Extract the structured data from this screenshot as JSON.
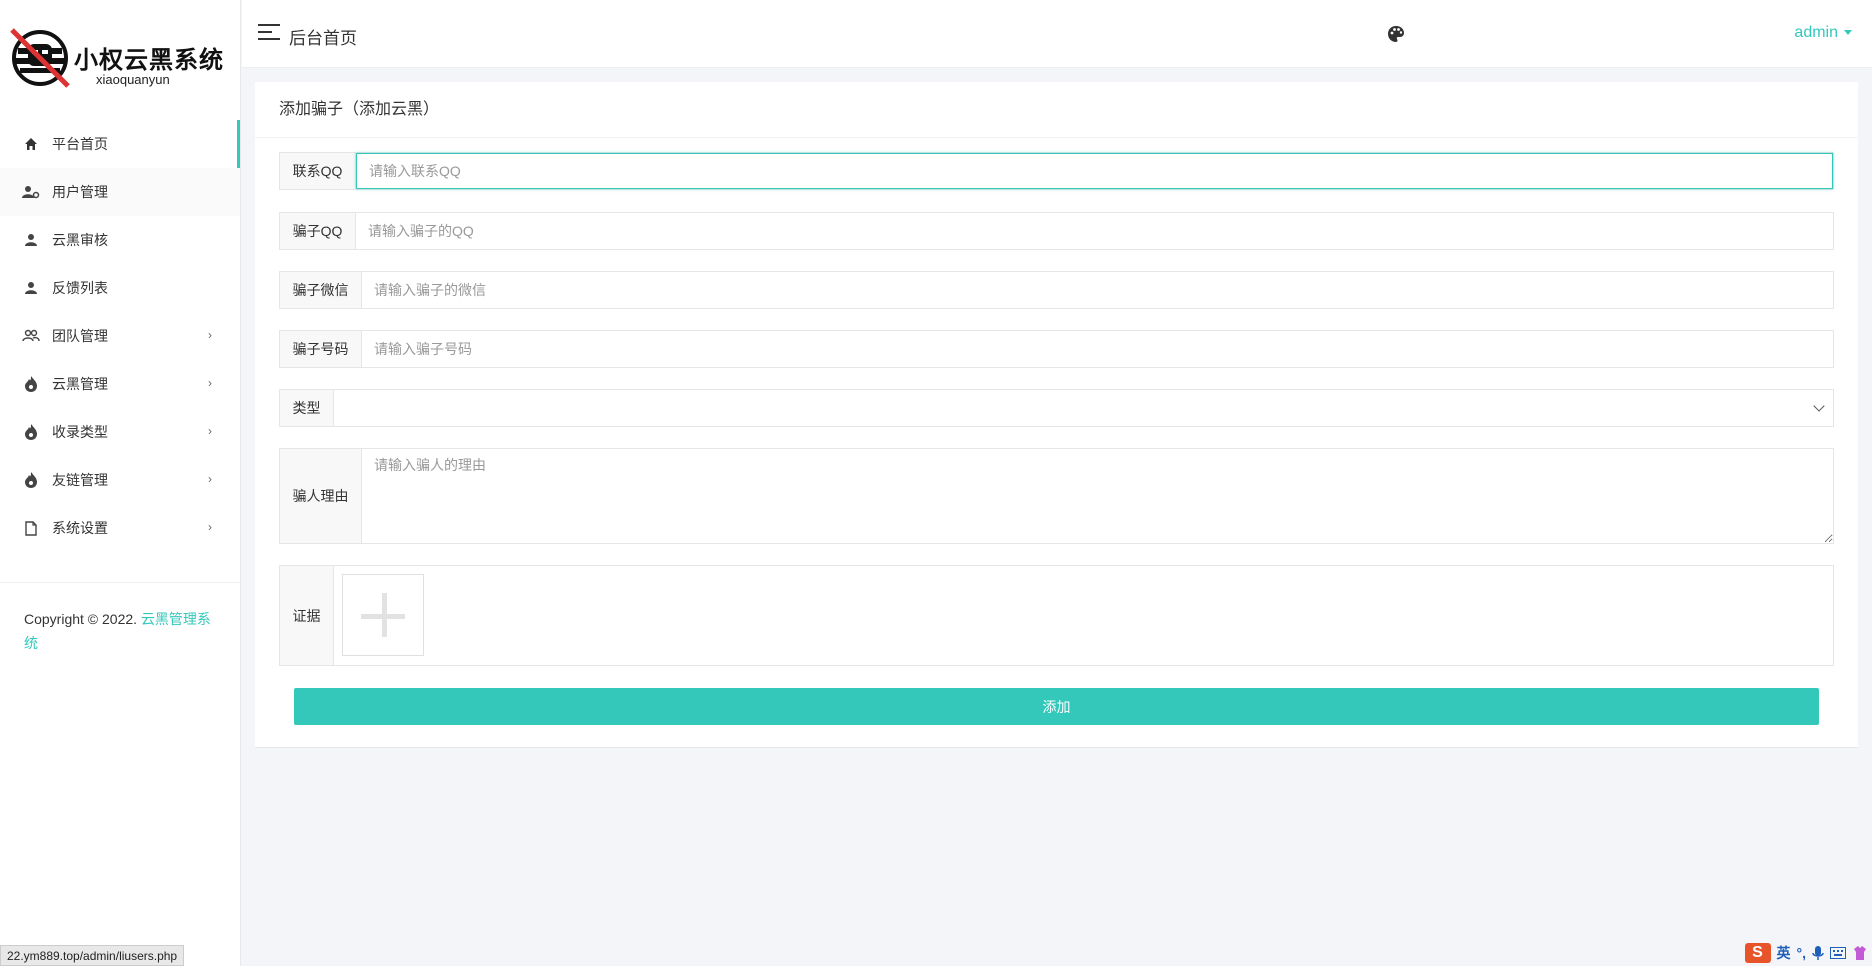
{
  "logo": {
    "title": "小权云黑系统",
    "subtitle": "xiaoquanyun"
  },
  "sidebar": {
    "items": [
      {
        "label": "平台首页",
        "icon": "home-icon"
      },
      {
        "label": "用户管理",
        "icon": "user-settings-icon"
      },
      {
        "label": "云黑审核",
        "icon": "user-icon"
      },
      {
        "label": "反馈列表",
        "icon": "user-icon"
      },
      {
        "label": "团队管理",
        "icon": "group-icon",
        "arrow": "›"
      },
      {
        "label": "云黑管理",
        "icon": "flame-icon",
        "arrow": "›"
      },
      {
        "label": "收录类型",
        "icon": "flame-icon",
        "arrow": "›"
      },
      {
        "label": "友链管理",
        "icon": "flame-icon",
        "arrow": "›"
      },
      {
        "label": "系统设置",
        "icon": "file-icon",
        "arrow": "›"
      }
    ],
    "copyright_text": "Copyright © 2022. ",
    "copyright_link": "云黑管理系统"
  },
  "header": {
    "title": "后台首页",
    "user": "admin"
  },
  "card": {
    "title": "添加骗子（添加云黑）"
  },
  "form": {
    "contact_qq": {
      "label": "联系QQ",
      "placeholder": "请输入联系QQ",
      "value": ""
    },
    "scammer_qq": {
      "label": "骗子QQ",
      "placeholder": "请输入骗子的QQ",
      "value": ""
    },
    "scammer_wechat": {
      "label": "骗子微信",
      "placeholder": "请输入骗子的微信",
      "value": ""
    },
    "scammer_phone": {
      "label": "骗子号码",
      "placeholder": "请输入骗子号码",
      "value": ""
    },
    "type": {
      "label": "类型",
      "value": ""
    },
    "reason": {
      "label": "骗人理由",
      "placeholder": "请输入骗人的理由"
    },
    "evidence": {
      "label": "证据"
    },
    "submit_label": "添加"
  },
  "status_bar": {
    "url": "22.ym889.top/admin/liusers.php"
  },
  "ime": {
    "logo": "S",
    "lang": "英"
  },
  "colors": {
    "accent": "#34c8bb",
    "background": "#f4f5f8"
  }
}
